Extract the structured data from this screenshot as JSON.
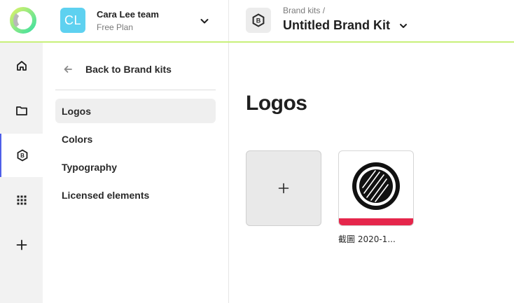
{
  "header": {
    "team": {
      "initials": "CL",
      "name": "Cara Lee team",
      "plan": "Free Plan",
      "avatar_color": "#5ed1f0"
    },
    "breadcrumb": "Brand kits /",
    "kit_title": "Untitled Brand Kit",
    "accent_color": "#c8f07a"
  },
  "rail": {
    "items": [
      {
        "icon": "home-icon"
      },
      {
        "icon": "folder-icon"
      },
      {
        "icon": "brand-kit-icon",
        "active": true
      },
      {
        "icon": "apps-grid-icon"
      },
      {
        "icon": "plus-icon"
      }
    ],
    "active_color": "#4f5fe8"
  },
  "sidebar": {
    "back_label": "Back to Brand kits",
    "items": [
      {
        "label": "Logos",
        "active": true
      },
      {
        "label": "Colors"
      },
      {
        "label": "Typography"
      },
      {
        "label": "Licensed elements"
      }
    ]
  },
  "main": {
    "title": "Logos",
    "logos": [
      {
        "caption": "截圖 2020-1...",
        "band_color": "#e5264b"
      }
    ]
  }
}
